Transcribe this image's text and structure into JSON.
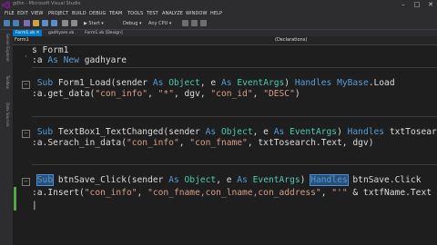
{
  "window": {
    "title": "gdhn - Microsoft Visual Studio",
    "btn_min": "–",
    "btn_max": "□",
    "btn_close": "✕"
  },
  "menu": [
    "FILE",
    "EDIT",
    "VIEW",
    "PROJECT",
    "BUILD",
    "DEBUG",
    "TEAM",
    "TOOLS",
    "TEST",
    "ANALYZE",
    "WINDOW",
    "HELP"
  ],
  "toolbar": {
    "start_label": "▶ Start ▾",
    "config_label": "Debug ▾",
    "platform_label": "Any CPU ▾"
  },
  "side_tabs": [
    "Server Explorer",
    "Toolbox",
    "Data Sources"
  ],
  "tabs": [
    {
      "label": "Form1.vb ✕"
    },
    {
      "label": "gadhyare.vb"
    },
    {
      "label": "Form1.vb [Design]"
    }
  ],
  "nav": {
    "left": "Form1",
    "right": "(Declarations)"
  },
  "code": {
    "l0_pre": "s Form1",
    "l1_pre": ":a ",
    "l1_kw": "As New",
    "l1_post": " gadhyare",
    "l2_pre": " ",
    "l2_kw1": "Sub",
    "l2_mid1": " Form1_Load(sender ",
    "l2_kw2": "As",
    "l2_sp1": " ",
    "l2_typ1": "Object",
    "l2_mid2": ", e ",
    "l2_kw3": "As",
    "l2_sp2": " ",
    "l2_typ2": "EventArgs",
    "l2_mid3": ") ",
    "l2_kw4": "Handles",
    "l2_sp3": " ",
    "l2_kw5": "MyBase",
    "l2_post": ".Load",
    "l3_pre": ":a.get_data(",
    "l3_s1": "\"con_info\"",
    "l3_mid1": ", ",
    "l3_s2": "\"*\"",
    "l3_mid2": ", dgv, ",
    "l3_s3": "\"con_id\"",
    "l3_mid3": ", ",
    "l3_s4": "\"DESC\"",
    "l3_post": ")",
    "l4_pre": " ",
    "l4_kw1": "Sub",
    "l4_mid1": " TextBox1_TextChanged(sender ",
    "l4_kw2": "As",
    "l4_sp1": " ",
    "l4_typ1": "Object",
    "l4_mid2": ", e ",
    "l4_kw3": "As",
    "l4_sp2": " ",
    "l4_typ2": "EventArgs",
    "l4_mid3": ") ",
    "l4_kw4": "Handles",
    "l4_post": " txtTosearch.Text",
    "l5_pre": ":a.Serach_in_data(",
    "l5_s1": "\"con_info\"",
    "l5_mid1": ", ",
    "l5_s2": "\"con_fname\"",
    "l5_post": ", txtTosearch.Text, dgv)",
    "l6_pre": " ",
    "l6_kw1": "Sub",
    "l6_mid1": " btnSave_Click(sender ",
    "l6_kw2": "As",
    "l6_sp1": " ",
    "l6_typ1": "Object",
    "l6_mid2": ", e ",
    "l6_kw3": "As",
    "l6_sp2": " ",
    "l6_typ2": "EventArgs",
    "l6_mid3": ") ",
    "l6_kw4": "Handles",
    "l6_post": " btnSave.Click",
    "l7_pre": ":a.Insert(",
    "l7_s1": "\"con_info\"",
    "l7_mid1": ", ",
    "l7_s2": "\"con_fname,con_lname,con_address\"",
    "l7_mid2": ", ",
    "l7_s3": "\"'\"",
    "l7_mid3": " & txtfName.Text & ",
    "l7_s4": "\"','\"",
    "l8": "|"
  }
}
